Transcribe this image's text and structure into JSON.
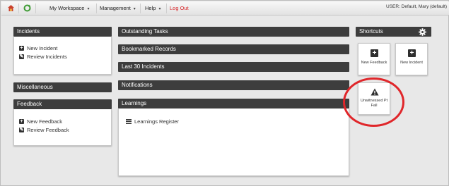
{
  "topbar": {
    "menus": [
      {
        "label": "My Workspace",
        "caret": "▾"
      },
      {
        "label": "Management",
        "caret": "▾"
      },
      {
        "label": "Help",
        "caret": "▾"
      }
    ],
    "logout_label": "Log Out",
    "user_info": "USER: Default, Mary (default)"
  },
  "incidents": {
    "title": "Incidents",
    "items": [
      {
        "label": "New Incident",
        "icon": "plus-icon"
      },
      {
        "label": "Review Incidents",
        "icon": "pencil-icon"
      }
    ]
  },
  "miscellaneous": {
    "title": "Miscellaneous"
  },
  "feedback": {
    "title": "Feedback",
    "items": [
      {
        "label": "New Feedback",
        "icon": "plus-icon"
      },
      {
        "label": "Review Feedback",
        "icon": "pencil-icon"
      }
    ]
  },
  "center": {
    "outstanding_tasks": "Outstanding Tasks",
    "bookmarked_records": "Bookmarked Records",
    "last_30_incidents": "Last 30 Incidents",
    "notifications": "Notifications",
    "learnings": {
      "title": "Learnings",
      "items": [
        {
          "label": "Learnings Register",
          "icon": "list-icon"
        }
      ]
    }
  },
  "shortcuts": {
    "title": "Shortcuts",
    "tiles": [
      {
        "label": "New Feedback",
        "icon": "plus-icon"
      },
      {
        "label": "New Incident",
        "icon": "plus-icon"
      },
      {
        "label": "Unwitnessed Pt Fall",
        "icon": "warning-icon"
      }
    ]
  },
  "colors": {
    "header_bg": "#3d3d3d",
    "highlight_circle": "#e0262a",
    "logout": "#d9282b"
  }
}
